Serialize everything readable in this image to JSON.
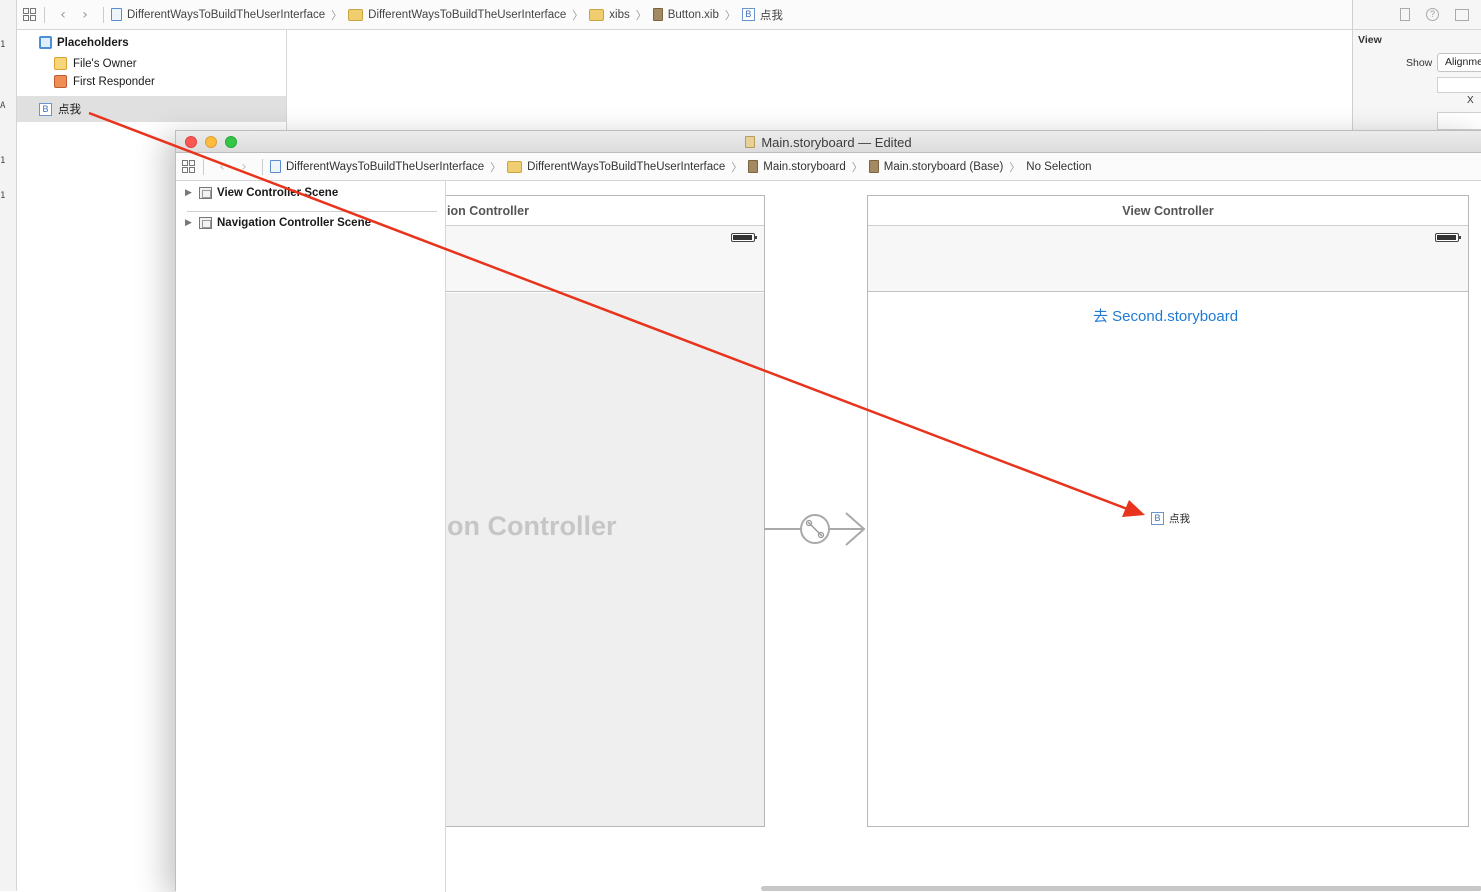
{
  "back_window": {
    "gutter_marks": [
      "1",
      "A",
      "1",
      "1"
    ],
    "breadcrumbs": [
      {
        "label": "DifferentWaysToBuildTheUserInterface",
        "icon": "project-doc-icon"
      },
      {
        "label": "DifferentWaysToBuildTheUserInterface",
        "icon": "folder-icon"
      },
      {
        "label": "xibs",
        "icon": "folder-icon"
      },
      {
        "label": "Button.xib",
        "icon": "xib-file-icon"
      },
      {
        "label": "点我",
        "icon": "button-b-icon"
      }
    ],
    "outline": {
      "placeholders_label": "Placeholders",
      "files_owner_label": "File's Owner",
      "first_responder_label": "First Responder",
      "button_label": "点我",
      "button_icon_letter": "B"
    },
    "inspector": {
      "section_title": "View",
      "show_label": "Show",
      "show_value": "Alignme",
      "x_label": "X"
    }
  },
  "front_window": {
    "title": "Main.storyboard — Edited",
    "breadcrumbs": [
      {
        "label": "DifferentWaysToBuildTheUserInterface",
        "icon": "project-doc-icon"
      },
      {
        "label": "DifferentWaysToBuildTheUserInterface",
        "icon": "folder-icon"
      },
      {
        "label": "Main.storyboard",
        "icon": "storyboard-file-icon"
      },
      {
        "label": "Main.storyboard (Base)",
        "icon": "storyboard-file-icon"
      },
      {
        "label": "No Selection",
        "icon": ""
      }
    ],
    "outline": {
      "scene1": "View Controller Scene",
      "scene2": "Navigation Controller Scene"
    },
    "canvas": {
      "nav_scene_title": "ion Controller",
      "nav_scene_body_label": "on Controller",
      "vc_scene_title": "View Controller",
      "vc_link_button": "去 Second.storyboard",
      "dropped_button_label": "点我",
      "dropped_button_letter": "B"
    }
  },
  "colors": {
    "annotation_arrow": "#e8341c",
    "link_blue": "#1f7ad4",
    "selection_gray": "#e0e0e0"
  }
}
